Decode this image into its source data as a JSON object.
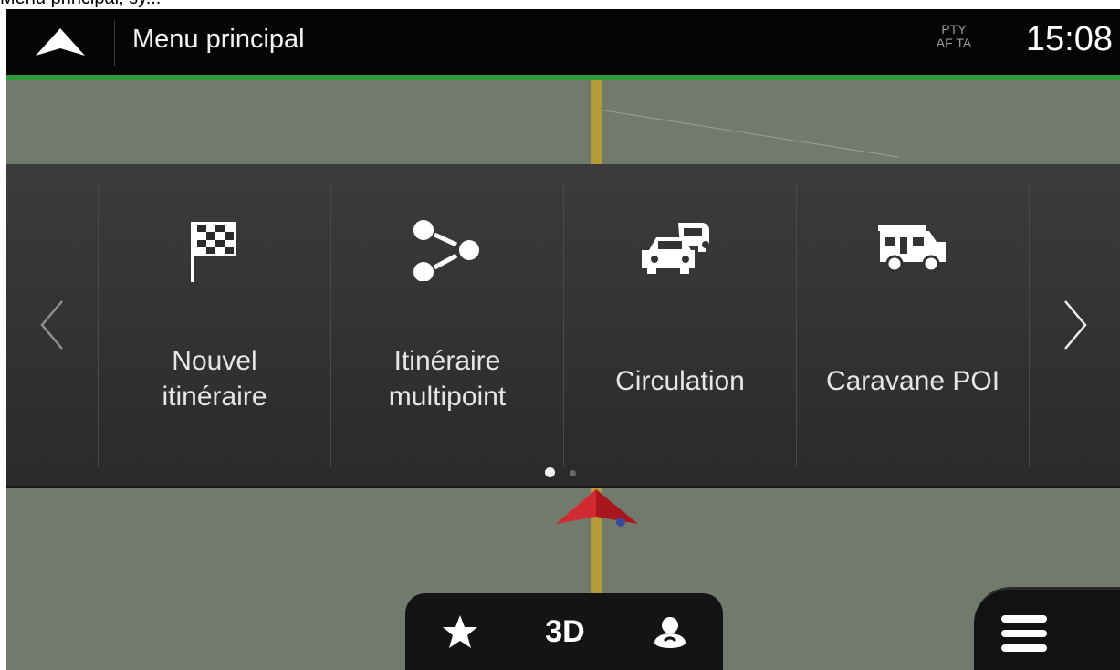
{
  "caption": "Menu principal; sy...",
  "header": {
    "title": "Menu principal",
    "radio_top": "PTY",
    "radio_bottom": "AF TA",
    "clock": "15:08"
  },
  "menu": {
    "items": [
      {
        "label_line1": "Nouvel",
        "label_line2": "itinéraire",
        "icon": "checkered-flag-icon"
      },
      {
        "label_line1": "Itinéraire",
        "label_line2": "multipoint",
        "icon": "multipoint-route-icon"
      },
      {
        "label": "Circulation",
        "icon": "traffic-cars-icon"
      },
      {
        "label": "Caravane POI",
        "icon": "caravan-icon"
      }
    ],
    "page_count": 2,
    "current_page": 1
  },
  "bottom_bar": {
    "view_mode": "3D",
    "favorite_icon": "star-icon",
    "user_icon": "user-location-icon",
    "menu_icon": "hamburger-menu-icon"
  },
  "colors": {
    "accent_green": "#2e9a3a",
    "map": "#727a6c",
    "panel": "#333333",
    "road": "#b59a3a",
    "marker": "#c8202a"
  }
}
